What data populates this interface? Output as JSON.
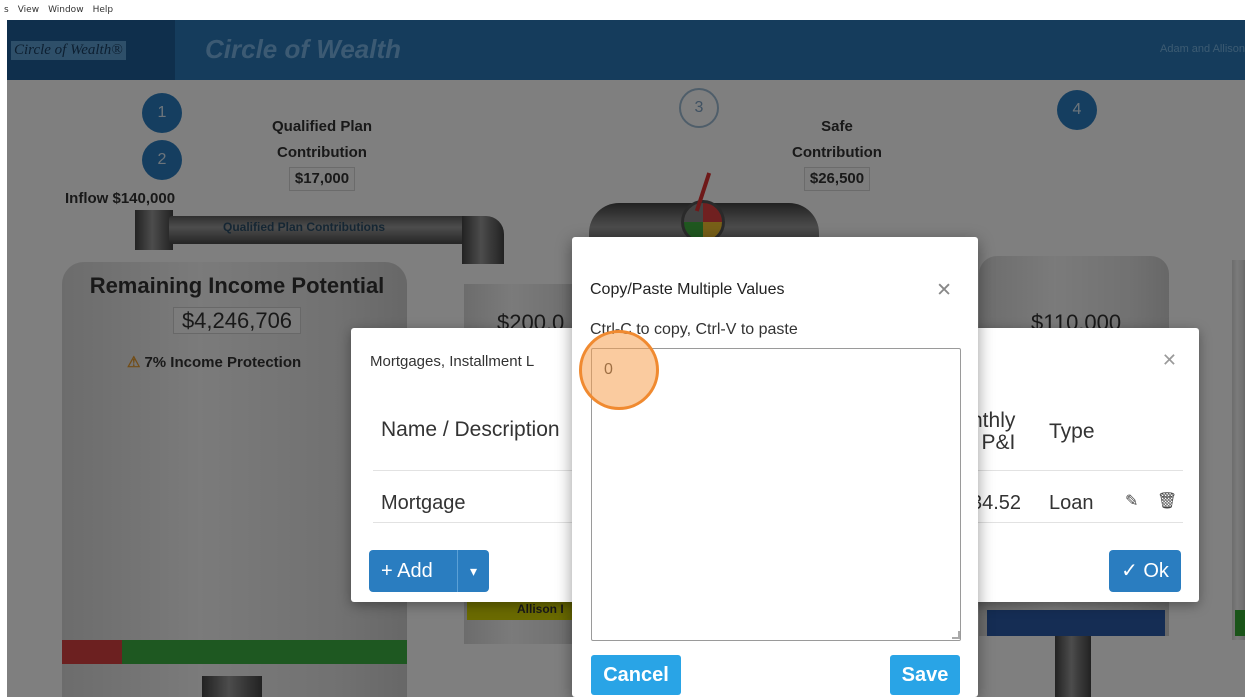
{
  "menubar": {
    "items": [
      "s",
      "View",
      "Window",
      "Help"
    ]
  },
  "app": {
    "logo_text": "Circle of Wealth®",
    "title": "Circle of Wealth",
    "user": "Adam and Allison"
  },
  "steps": [
    "1",
    "2",
    "3",
    "4"
  ],
  "qualified": {
    "line1": "Qualified Plan",
    "line2": "Contribution",
    "amount": "$17,000"
  },
  "safe": {
    "line1": "Safe",
    "line2": "Contribution",
    "amount": "$26,500"
  },
  "inflow": "Inflow $140,000",
  "pipe_label": "Qualified Plan Contributions",
  "tank": {
    "title": "Remaining Income Potential",
    "value": "$4,246,706",
    "protection": "7% Income Protection",
    "mid_value": "$200,0",
    "right_value": "$110,000",
    "allison": "Allison I"
  },
  "bg_modal": {
    "title": "Mortgages, Installment L",
    "col_name": "Name / Description",
    "col_pi_1": "nthly",
    "col_pi_2": "P&I",
    "col_type": "Type",
    "row": {
      "name": "Mortgage",
      "amount": "34.52",
      "type": "Loan"
    },
    "add_label": "+ Add",
    "ok_label": "✓ Ok"
  },
  "dialog": {
    "title": "Copy/Paste Multiple Values",
    "hint": "Ctrl-C to copy, Ctrl-V to paste",
    "value": "0",
    "cancel": "Cancel",
    "save": "Save"
  },
  "colors": {
    "appbar": "#2a78b8",
    "step": "#2a7dc0",
    "button": "#29a4e6",
    "marker": "#f08a30"
  }
}
